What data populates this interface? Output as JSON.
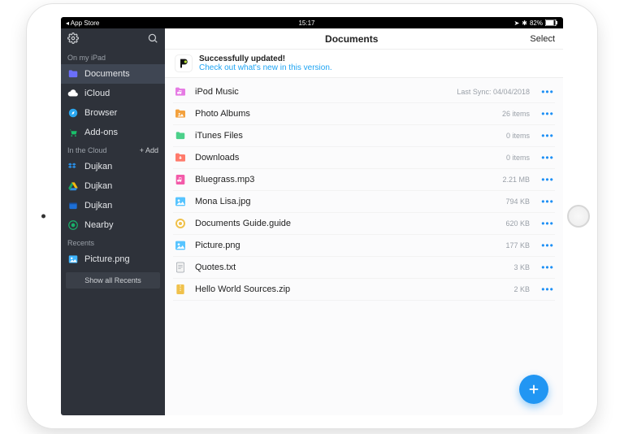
{
  "status": {
    "back": "App Store",
    "time": "15:17",
    "battery": "82%"
  },
  "sidebar": {
    "sections": [
      {
        "label": "On my iPad",
        "add": false,
        "items": [
          {
            "icon": "folder-icon",
            "color": "#6b6ffb",
            "label": "Documents",
            "selected": true
          },
          {
            "icon": "cloud-icon",
            "color": "#ffffff",
            "label": "iCloud"
          },
          {
            "icon": "compass-icon",
            "color": "#2aa7f0",
            "label": "Browser"
          },
          {
            "icon": "cart-icon",
            "color": "#19c06a",
            "label": "Add-ons"
          }
        ]
      },
      {
        "label": "In the Cloud",
        "add": true,
        "add_label": "+ Add",
        "items": [
          {
            "icon": "dropbox-icon",
            "color": "#2a8fe6",
            "label": "Dujkan"
          },
          {
            "icon": "gdrive-icon",
            "color": "#f3b90c",
            "label": "Dujkan"
          },
          {
            "icon": "box-icon",
            "color": "#1d6fd6",
            "label": "Dujkan"
          },
          {
            "icon": "nearby-icon",
            "color": "#18b26b",
            "label": "Nearby"
          }
        ]
      },
      {
        "label": "Recents",
        "add": false,
        "items": [
          {
            "icon": "image-icon",
            "color": "#3fb6ff",
            "label": "Picture.png"
          }
        ]
      }
    ],
    "show_all": "Show all Recents"
  },
  "header": {
    "title": "Documents",
    "select": "Select"
  },
  "banner": {
    "title": "Successfully updated!",
    "link": "Check out what's new in this version."
  },
  "files": [
    {
      "icon": "music-folder-icon",
      "color": "#e67be4",
      "name": "iPod Music",
      "meta": "Last Sync: 04/04/2018"
    },
    {
      "icon": "photos-folder-icon",
      "color": "#f3a13d",
      "name": "Photo Albums",
      "meta": "26 items"
    },
    {
      "icon": "folder-icon",
      "color": "#4cd08a",
      "name": "iTunes Files",
      "meta": "0 items"
    },
    {
      "icon": "download-folder-icon",
      "color": "#ff7a6b",
      "name": "Downloads",
      "meta": "0 items"
    },
    {
      "icon": "audio-file-icon",
      "color": "#f35aa9",
      "name": "Bluegrass.mp3",
      "meta": "2.21 MB"
    },
    {
      "icon": "image-file-icon",
      "color": "#57c4ff",
      "name": "Mona Lisa.jpg",
      "meta": "794 KB"
    },
    {
      "icon": "guide-file-icon",
      "color": "#f0c14b",
      "name": "Documents Guide.guide",
      "meta": "620 KB"
    },
    {
      "icon": "image-file-icon",
      "color": "#57c4ff",
      "name": "Picture.png",
      "meta": "177 KB"
    },
    {
      "icon": "text-file-icon",
      "color": "#9aa0a8",
      "name": "Quotes.txt",
      "meta": "3 KB"
    },
    {
      "icon": "zip-file-icon",
      "color": "#f0c14b",
      "name": "Hello World Sources.zip",
      "meta": "2 KB"
    }
  ]
}
